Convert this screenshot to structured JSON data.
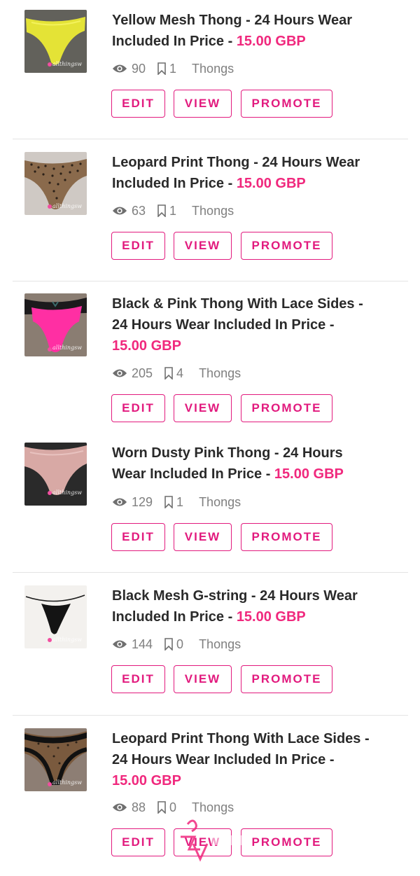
{
  "watermark": "allthingsw",
  "buttons": {
    "edit": "EDIT",
    "view": "VIEW",
    "promote": "PROMOTE"
  },
  "colors": {
    "accent": "#e21a7e",
    "price": "#f0287d"
  },
  "listings": [
    {
      "title_line1": "Yellow Mesh Thong - 24 Hours Wear",
      "title_line2": "Included In Price - ",
      "title_line3": "",
      "price": "15.00 GBP",
      "views": "90",
      "saves": "1",
      "category": "Thongs"
    },
    {
      "title_line1": "Leopard Print Thong - 24 Hours Wear",
      "title_line2": "Included In Price - ",
      "title_line3": "",
      "price": "15.00 GBP",
      "views": "63",
      "saves": "1",
      "category": "Thongs"
    },
    {
      "title_line1": "Black & Pink Thong With Lace Sides -",
      "title_line2": "24 Hours Wear Included In Price -",
      "title_line3": "",
      "price": "15.00 GBP",
      "views": "205",
      "saves": "4",
      "category": "Thongs"
    },
    {
      "title_line1": "Worn Dusty Pink Thong - 24 Hours",
      "title_line2": "Wear Included In Price - ",
      "title_line3": "",
      "price": "15.00 GBP",
      "views": "129",
      "saves": "1",
      "category": "Thongs"
    },
    {
      "title_line1": "Black Mesh G-string - 24 Hours Wear",
      "title_line2": "Included In Price - ",
      "title_line3": "",
      "price": "15.00 GBP",
      "views": "144",
      "saves": "0",
      "category": "Thongs"
    },
    {
      "title_line1": "Leopard Print Thong With Lace Sides -",
      "title_line2": "24 Hours Wear Included In Price -",
      "title_line3": "",
      "price": "15.00 GBP",
      "views": "88",
      "saves": "0",
      "category": "Thongs"
    }
  ]
}
